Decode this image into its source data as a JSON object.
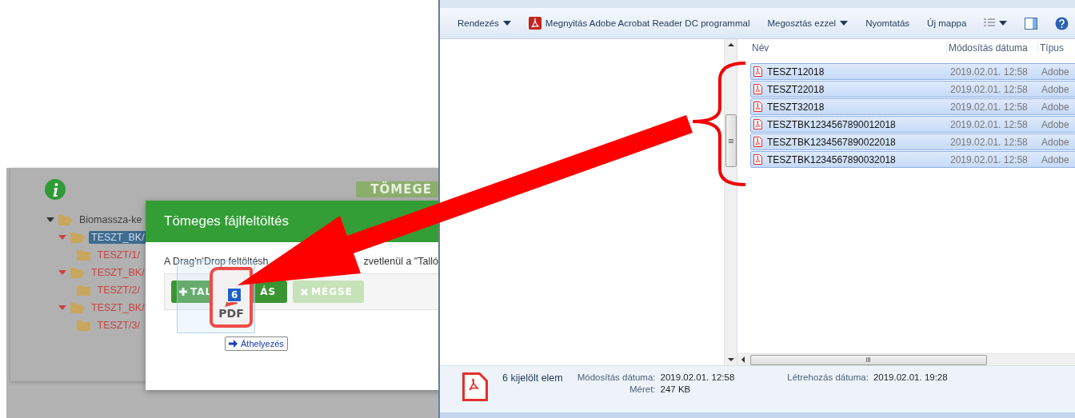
{
  "webapp": {
    "top_button": "TÖMEGE",
    "tree": [
      {
        "label": "Biomassza-ke",
        "expanded": true,
        "selected": false,
        "children": [
          {
            "label": "TESZT_BK/",
            "expanded": true,
            "selected": true,
            "children": [
              {
                "label": "TESZT/1/",
                "selected": false
              }
            ]
          },
          {
            "label": "TESZT_BK/",
            "expanded": true,
            "selected": false,
            "children": [
              {
                "label": "TESZT/2/",
                "selected": false
              }
            ]
          },
          {
            "label": "TESZT_BK/",
            "expanded": true,
            "selected": false,
            "children": [
              {
                "label": "TESZT/3/",
                "selected": false
              }
            ]
          }
        ]
      }
    ]
  },
  "modal": {
    "title": "Tömeges fájlfeltöltés",
    "text_parts": [
      "A Drag'n'Drop feltöltésh",
      "zvetlenül a \"Talló"
    ],
    "buttons": [
      {
        "label_parts": [
          "TAL",
          "ÁS"
        ],
        "kind": "primary"
      },
      {
        "label_parts": [
          "MÉGSE"
        ],
        "kind": "cancel"
      }
    ]
  },
  "drag": {
    "count": "6",
    "file_label": "PDF",
    "tooltip": "Áthelyezés"
  },
  "explorer": {
    "toolbar": [
      {
        "label": "Rendezés",
        "kind": "menu"
      },
      {
        "label": "Megnyitás Adobe Acrobat Reader DC programmal",
        "kind": "app"
      },
      {
        "label": "Megosztás ezzel",
        "kind": "menu"
      },
      {
        "label": "Nyomtatás",
        "kind": "plain"
      },
      {
        "label": "Új mappa",
        "kind": "plain"
      }
    ],
    "columns": [
      "Név",
      "Módosítás dátuma",
      "Típus"
    ],
    "files": [
      {
        "name": "TESZT12018",
        "modified": "2019.02.01. 12:58",
        "type": "Adobe",
        "selected": true
      },
      {
        "name": "TESZT22018",
        "modified": "2019.02.01. 12:58",
        "type": "Adobe",
        "selected": true
      },
      {
        "name": "TESZT32018",
        "modified": "2019.02.01. 12:58",
        "type": "Adobe",
        "selected": true
      },
      {
        "name": "TESZTBK1234567890012018",
        "modified": "2019.02.01. 12:58",
        "type": "Adobe",
        "selected": true
      },
      {
        "name": "TESZTBK1234567890022018",
        "modified": "2019.02.01. 12:58",
        "type": "Adobe",
        "selected": true
      },
      {
        "name": "TESZTBK1234567890032018",
        "modified": "2019.02.01. 12:58",
        "type": "Adobe",
        "selected": true
      }
    ],
    "details": {
      "summary": "6 kijelölt elem",
      "fields": [
        {
          "label": "Módosítás dátuma:",
          "value": "2019.02.01. 12:58"
        },
        {
          "label": "Méret:",
          "value": "247 KB"
        },
        {
          "label": "Létrehozás dátuma:",
          "value": "2019.02.01. 19:28"
        }
      ]
    }
  }
}
